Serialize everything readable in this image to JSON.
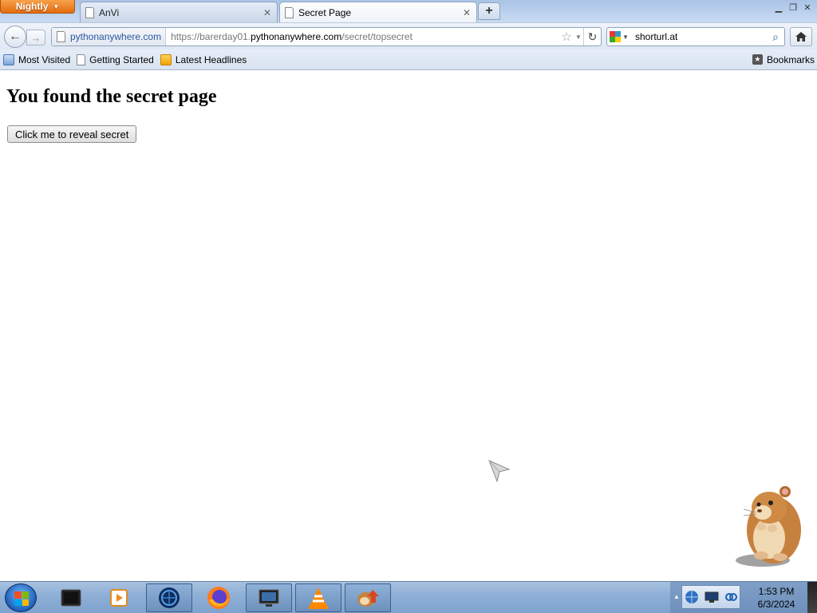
{
  "browser": {
    "app_menu_label": "Nightly",
    "tabs": [
      {
        "title": "AnVi",
        "active": false
      },
      {
        "title": "Secret Page",
        "active": true
      }
    ],
    "new_tab_label": "+",
    "site_identity": "pythonanywhere.com",
    "url": {
      "prefix": "https://barerday01.",
      "domain": "pythonanywhere.com",
      "path": "/secret/topsecret"
    },
    "search": {
      "engine_icon": "google-icon",
      "value": "shorturl.at"
    },
    "bookmarks": [
      {
        "label": "Most Visited",
        "icon": "most-visited-icon"
      },
      {
        "label": "Getting Started",
        "icon": "page-icon"
      },
      {
        "label": "Latest Headlines",
        "icon": "rss-icon"
      }
    ],
    "bookmarks_menu_label": "Bookmarks"
  },
  "page": {
    "heading": "You found the secret page",
    "button_label": "Click me to reveal secret"
  },
  "taskbar": {
    "items": [
      {
        "name": "terminal-icon",
        "running": false
      },
      {
        "name": "media-player-icon",
        "running": false
      },
      {
        "name": "browser-globe-icon",
        "running": true
      },
      {
        "name": "firefox-icon",
        "running": false
      },
      {
        "name": "monitor-icon",
        "running": true
      },
      {
        "name": "vlc-icon",
        "running": true
      },
      {
        "name": "hamster-app-icon",
        "running": true
      }
    ],
    "clock": {
      "time": "1:53 PM",
      "date": "6/3/2024"
    }
  },
  "colors": {
    "app_menu": "#e46c10",
    "taskbar": "#8fb0d6",
    "link_identity": "#2a5aa0"
  }
}
